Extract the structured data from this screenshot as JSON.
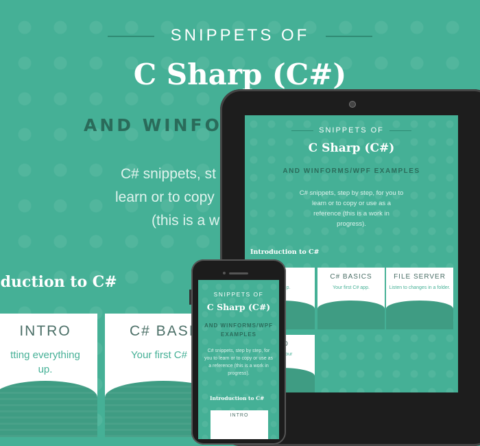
{
  "hero": {
    "kicker": "SNIPPETS OF",
    "title": "C Sharp (C#)",
    "subtitle": "AND WINFORMS",
    "desc_line1": "C# snippets, st",
    "desc_line2": "learn or to copy",
    "desc_line3": "(this is a w",
    "section": "oduction to C#",
    "cards": [
      {
        "title": "INTRO",
        "desc1": "tting everything",
        "desc2": "up."
      },
      {
        "title": "C# BASI",
        "desc1": "Your first C#",
        "desc2": ""
      }
    ]
  },
  "tablet": {
    "kicker": "SNIPPETS OF",
    "title": "C Sharp (C#)",
    "subtitle": "AND WINFORMS/WPF EXAMPLES",
    "desc_line1": "C# snippets, step by step, for you to",
    "desc_line2": "learn or to copy or use as a",
    "desc_line3": "reference (this is a work in",
    "desc_line4": "progress).",
    "section": "Introduction to C#",
    "cards": [
      {
        "title": "O",
        "desc": "thing up."
      },
      {
        "title": "C# BASICS",
        "desc": "Your first C# app."
      },
      {
        "title": "FILE SERVER",
        "desc": "Listen to changes in a folder."
      }
    ],
    "card_row2": {
      "title": "LLO",
      "desc1": "me in your",
      "desc2": "n."
    }
  },
  "phone": {
    "kicker": "SNIPPETS OF",
    "title": "C Sharp (C#)",
    "subtitle": "AND WINFORMS/WPF EXAMPLES",
    "desc_line1": "C# snippets, step by step, for",
    "desc_line2": "you to learn or to copy or use as",
    "desc_line3": "a reference (this is a work in",
    "desc_line4": "progress).",
    "section": "Introduction to C#",
    "card_title": "INTRO"
  }
}
